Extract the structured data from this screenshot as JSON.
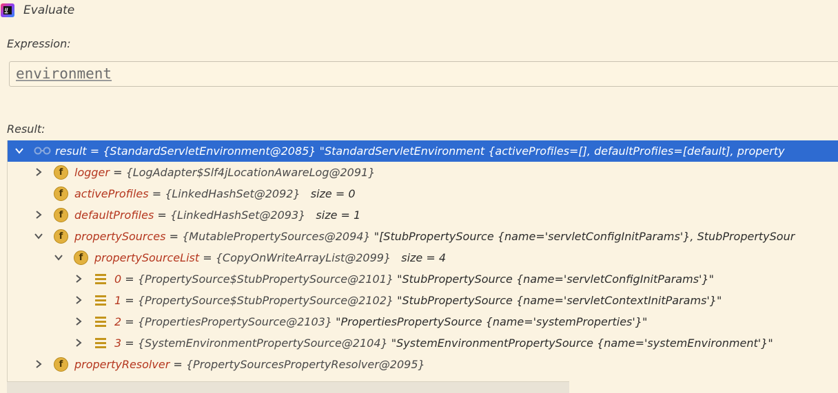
{
  "window": {
    "title": "Evaluate"
  },
  "expression": {
    "label": "Expression:",
    "value": "environment"
  },
  "result": {
    "label": "Result:",
    "rows": [
      {
        "name": "result",
        "type": "{StandardServletEnvironment@2085}",
        "value": "\"StandardServletEnvironment {activeProfiles=[], defaultProfiles=[default], property",
        "expanded": true
      },
      {
        "name": "logger",
        "type": "{LogAdapter$Slf4jLocationAwareLog@2091}",
        "expanded": false
      },
      {
        "name": "activeProfiles",
        "type": "{LinkedHashSet@2092}",
        "size": "size = 0"
      },
      {
        "name": "defaultProfiles",
        "type": "{LinkedHashSet@2093}",
        "size": "size = 1",
        "expanded": false
      },
      {
        "name": "propertySources",
        "type": "{MutablePropertySources@2094}",
        "value": "\"[StubPropertySource {name='servletConfigInitParams'}, StubPropertySour",
        "expanded": true
      },
      {
        "name": "propertySourceList",
        "type": "{CopyOnWriteArrayList@2099}",
        "size": "size = 4",
        "expanded": true
      },
      {
        "name": "0",
        "type": "{PropertySource$StubPropertySource@2101}",
        "value": "\"StubPropertySource {name='servletConfigInitParams'}\""
      },
      {
        "name": "1",
        "type": "{PropertySource$StubPropertySource@2102}",
        "value": "\"StubPropertySource {name='servletContextInitParams'}\""
      },
      {
        "name": "2",
        "type": "{PropertiesPropertySource@2103}",
        "value": "\"PropertiesPropertySource {name='systemProperties'}\""
      },
      {
        "name": "3",
        "type": "{SystemEnvironmentPropertySource@2104}",
        "value": "\"SystemEnvironmentPropertySource {name='systemEnvironment'}\""
      },
      {
        "name": "propertyResolver",
        "type": "{PropertySourcesPropertyResolver@2095}",
        "expanded": false
      }
    ]
  },
  "icons": {
    "field_badge": "f",
    "field_icon": "field-icon",
    "array_icon": "array-element-icon",
    "watch_icon": "watch-glasses-icon"
  },
  "colors": {
    "selection": "#2e6bd1",
    "field_name": "#b5371f",
    "background": "#fbf3e1",
    "badge": "#e2b13f"
  }
}
